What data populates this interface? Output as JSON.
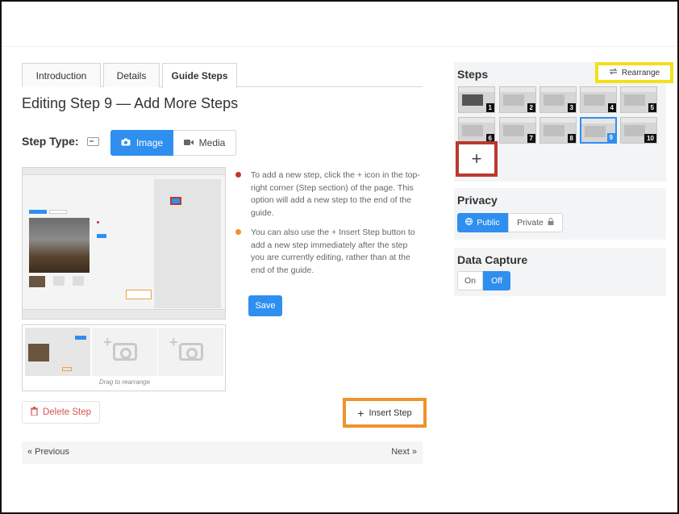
{
  "tabs": [
    {
      "label": "Introduction"
    },
    {
      "label": "Details"
    },
    {
      "label": "Guide Steps"
    }
  ],
  "page_title": "Editing Step 9 — Add More Steps",
  "step_type": {
    "label": "Step Type:",
    "options": [
      "Image",
      "Media"
    ],
    "selected": "Image"
  },
  "thumbnail_strip": {
    "drag_text": "Drag to rearrange"
  },
  "instructions": [
    "To add a new step, click the + icon in the top-right corner (Step section) of the page. This option will add a new step to the end of the guide.",
    "You can also use the + Insert Step button to add a new step immediately after the step you are currently editing, rather than at the end of the guide."
  ],
  "buttons": {
    "save": "Save",
    "delete_step": "Delete Step",
    "insert_step": "Insert Step",
    "add_step": "+"
  },
  "pager": {
    "previous": "« Previous",
    "next": "Next »"
  },
  "steps_panel": {
    "title": "Steps",
    "rearrange": "Rearrange",
    "thumbnails": [
      "1",
      "2",
      "3",
      "4",
      "5",
      "6",
      "7",
      "8",
      "9",
      "10"
    ],
    "selected": "9"
  },
  "privacy": {
    "title": "Privacy",
    "public": "Public",
    "private": "Private",
    "selected": "Public"
  },
  "data_capture": {
    "title": "Data Capture",
    "on": "On",
    "off": "Off",
    "selected": "Off"
  },
  "colors": {
    "accent": "#2f8fef",
    "highlight_yellow": "#f3e01b",
    "highlight_red": "#b83a2e",
    "highlight_orange": "#f0922c"
  }
}
